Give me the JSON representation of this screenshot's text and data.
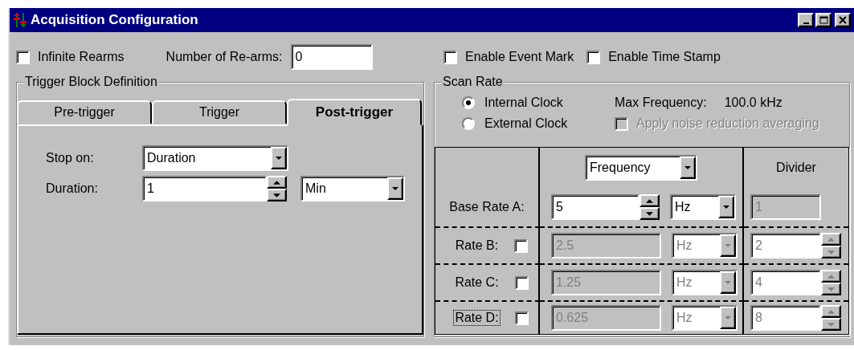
{
  "window": {
    "title": "Acquisition Configuration"
  },
  "top_row": {
    "infinite_rearms": {
      "label": "Infinite Rearms",
      "checked": false
    },
    "rearms": {
      "label": "Number of Re-arms:",
      "value": "0"
    },
    "event_mark": {
      "label": "Enable Event Mark",
      "checked": false
    },
    "time_stamp": {
      "label": "Enable Time Stamp",
      "checked": false
    }
  },
  "trigger_block": {
    "title": "Trigger Block Definition",
    "tabs": [
      {
        "label": "Pre-trigger",
        "selected": false
      },
      {
        "label": "Trigger",
        "selected": false
      },
      {
        "label": "Post-trigger",
        "selected": true
      }
    ],
    "stop_on": {
      "label": "Stop on:",
      "value": "Duration"
    },
    "duration": {
      "label": "Duration:",
      "value": "1",
      "unit": "Min"
    }
  },
  "scan_rate": {
    "title": "Scan Rate",
    "clocks": [
      {
        "label": "Internal Clock",
        "selected": true
      },
      {
        "label": "External Clock",
        "selected": false
      }
    ],
    "max_frequency": {
      "label": "Max Frequency:",
      "value": "100.0 kHz"
    },
    "noise_reduction": {
      "label": "Apply noise reduction averaging",
      "checked": false,
      "disabled": true
    },
    "table": {
      "mode": "Frequency",
      "divider_header": "Divider",
      "rows": [
        {
          "kind": "base",
          "label": "Base Rate A:",
          "value": "5",
          "unit": "Hz",
          "divider": "1",
          "focused": false
        },
        {
          "kind": "derived",
          "label": "Rate B:",
          "checked": false,
          "value": "2.5",
          "unit": "Hz",
          "divider": "2",
          "focused": false
        },
        {
          "kind": "derived",
          "label": "Rate C:",
          "checked": false,
          "value": "1.25",
          "unit": "Hz",
          "divider": "4",
          "focused": false
        },
        {
          "kind": "derived",
          "label": "Rate D:",
          "checked": false,
          "value": "0.625",
          "unit": "Hz",
          "divider": "8",
          "focused": true
        }
      ]
    }
  }
}
